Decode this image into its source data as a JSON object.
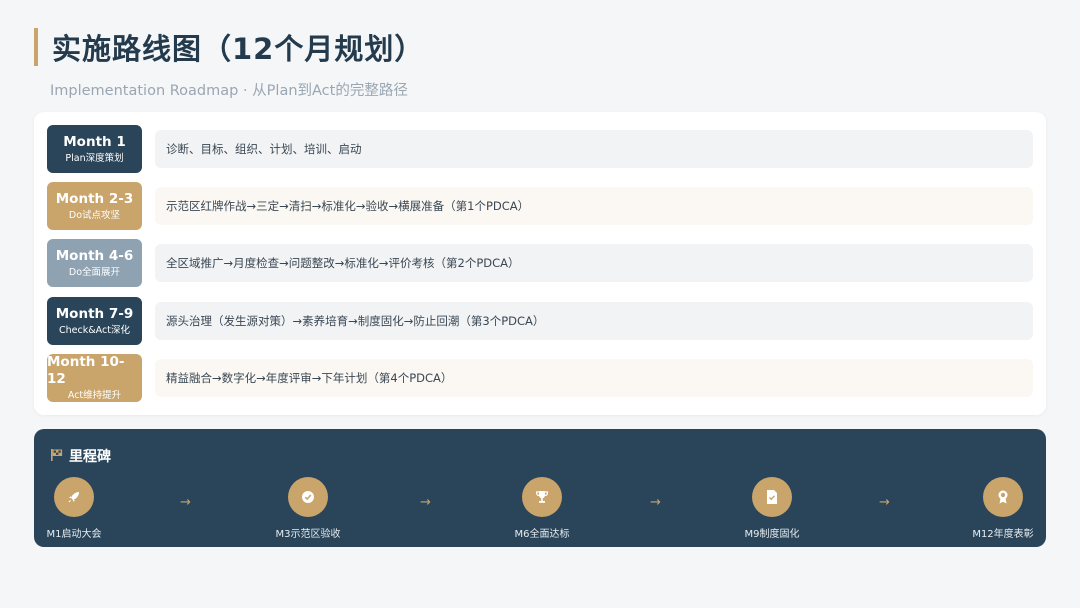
{
  "header": {
    "title": "实施路线图（12个月规划）",
    "subtitle": "Implementation Roadmap · 从Plan到Act的完整路径"
  },
  "phases": [
    {
      "month": "Month 1",
      "sub": "Plan深度策划",
      "desc": "诊断、目标、组织、计划、培训、启动"
    },
    {
      "month": "Month 2-3",
      "sub": "Do试点攻坚",
      "desc": "示范区红牌作战→三定→清扫→标准化→验收→横展准备（第1个PDCA）"
    },
    {
      "month": "Month 4-6",
      "sub": "Do全面展开",
      "desc": "全区域推广→月度检查→问题整改→标准化→评价考核（第2个PDCA）"
    },
    {
      "month": "Month 7-9",
      "sub": "Check&Act深化",
      "desc": "源头治理（发生源对策）→素养培育→制度固化→防止回潮（第3个PDCA）"
    },
    {
      "month": "Month 10-12",
      "sub": "Act维持提升",
      "desc": "精益融合→数字化→年度评审→下年计划（第4个PDCA）"
    }
  ],
  "milestones": {
    "title": "里程碑",
    "arrow": "→",
    "items": [
      {
        "label": "M1启动大会",
        "icon": "rocket-icon"
      },
      {
        "label": "M3示范区验收",
        "icon": "check-circle-icon"
      },
      {
        "label": "M6全面达标",
        "icon": "trophy-icon"
      },
      {
        "label": "M9制度固化",
        "icon": "document-icon"
      },
      {
        "label": "M12年度表彰",
        "icon": "award-icon"
      }
    ]
  },
  "colors": {
    "navy": "#2a4559",
    "gold": "#c9a46b",
    "grey": "#8fa2b2"
  }
}
